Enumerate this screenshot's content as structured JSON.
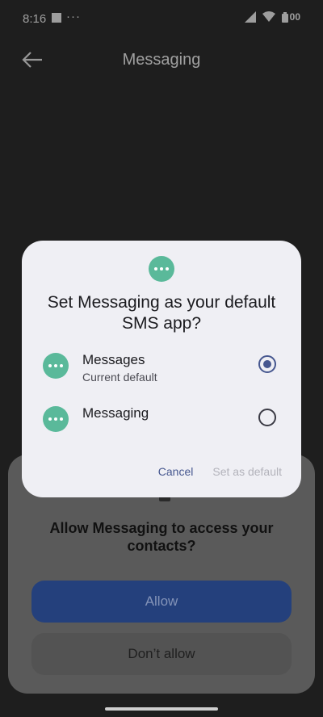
{
  "status_bar": {
    "time": "8:16",
    "overflow_dots": "···",
    "battery_text": "00"
  },
  "app_bar": {
    "title": "Messaging"
  },
  "permission_sheet": {
    "title": "Allow Messaging to access your contacts?",
    "allow_label": "Allow",
    "deny_label": "Don’t allow"
  },
  "dialog": {
    "title": "Set Messaging as your default SMS app?",
    "options": [
      {
        "label": "Messages",
        "sublabel": "Current default",
        "selected": true
      },
      {
        "label": "Messaging",
        "sublabel": "",
        "selected": false
      }
    ],
    "cancel_label": "Cancel",
    "confirm_label": "Set as default"
  },
  "colors": {
    "accent": "#46578f",
    "app_icon": "#5ab99a",
    "dialog_bg": "#efeff4"
  }
}
